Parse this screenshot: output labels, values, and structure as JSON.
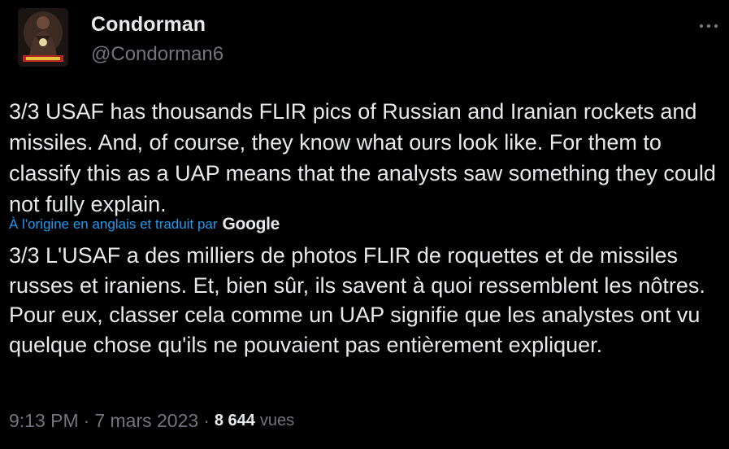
{
  "author": {
    "display_name": "Condorman",
    "handle": "@Condorman6",
    "avatar_icon": "avatar-image"
  },
  "menu": {
    "more_icon": "more-horizontal-icon"
  },
  "tweet": {
    "text": "3/3 USAF has thousands FLIR pics of Russian and Iranian rockets and missiles. And, of course, they know what ours look like. For them to classify this as a UAP means that the analysts saw something they could not fully explain.",
    "translation_note": "À l'origine en anglais et traduit par",
    "translation_provider": "Google",
    "translated_text": "3/3 L'USAF a des milliers de photos FLIR de roquettes et de missiles russes et iraniens. Et, bien sûr, ils savent à quoi ressemblent les nôtres. Pour eux, classer cela comme un UAP signifie que les analystes ont vu quelque chose qu'ils ne pouvaient pas entièrement expliquer."
  },
  "meta": {
    "time": "9:13 PM",
    "separator": "·",
    "date": "7 mars 2023",
    "views_count": "8 644",
    "views_label": "vues"
  },
  "colors": {
    "background": "#000000",
    "primary_text": "#e7e9ea",
    "secondary_text": "#71767b",
    "link": "#1d9bf0"
  }
}
